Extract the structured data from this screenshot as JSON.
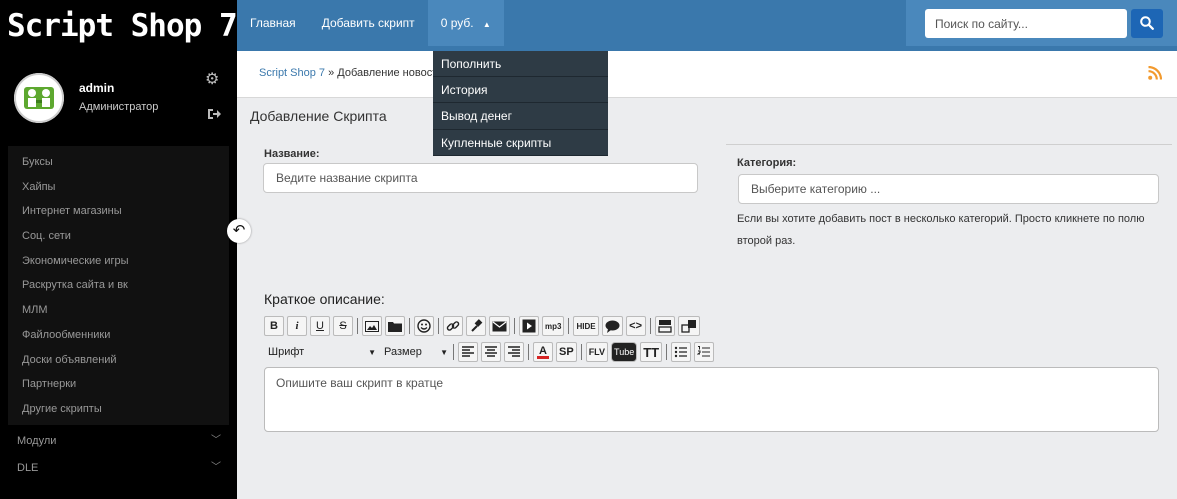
{
  "sidebar": {
    "logo": "Script Shop 7",
    "user": {
      "name": "admin",
      "role": "Администратор"
    },
    "icons": {
      "settings": "gear-icon",
      "logout": "logout-icon",
      "collapse": "back-arrow-icon"
    },
    "categories": [
      "Буксы",
      "Хайпы",
      "Интернет магазины",
      "Соц. сети",
      "Экономические игры",
      "Раскрутка сайта и вк",
      "МЛМ",
      "Файлообменники",
      "Доски объявлений",
      "Партнерки",
      "Другие скрипты"
    ],
    "sections": [
      {
        "label": "Модули"
      },
      {
        "label": "DLE"
      }
    ]
  },
  "topnav": {
    "items": [
      "Главная",
      "Добавить скрипт"
    ],
    "balance": "0 руб.",
    "balance_menu": [
      "Пополнить",
      "История",
      "Вывод денег",
      "Купленные скрипты"
    ],
    "search_placeholder": "Поиск по сайту..."
  },
  "breadcrumb": {
    "root": "Script Shop 7",
    "separator": "»",
    "current": "Добавление новости"
  },
  "form": {
    "title": "Добавление Скрипта",
    "name_label": "Название:",
    "name_placeholder": "Ведите название скрипта",
    "category_label": "Категория:",
    "category_placeholder": "Выберите категорию ...",
    "category_hint": "Если вы хотите добавить пост в несколько категорий. Просто кликнете по полю второй раз.",
    "short_desc_label": "Краткое описание:",
    "short_desc_placeholder": "Опишите ваш скрипт в кратце",
    "toolbar": {
      "font_label": "Шрифт",
      "size_label": "Размер",
      "mp3": "mp3",
      "hide": "HIDE",
      "sp": "SP",
      "flv": "FLV",
      "tube": "Tube",
      "tt": "TT"
    }
  },
  "colors": {
    "sidebar_bg": "#000000",
    "topbar_bg": "#3a78ac",
    "search_button": "#1d66b5",
    "dropdown_bg": "#2e3b45",
    "rss": "#f29a2e"
  }
}
